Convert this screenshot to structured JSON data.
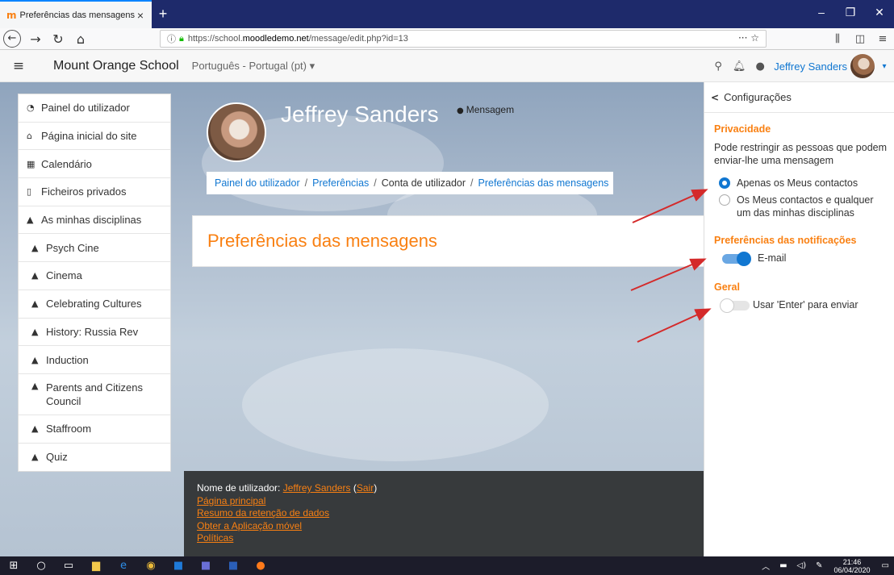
{
  "browser": {
    "tab_title": "Preferências das mensagens",
    "favicon": "m",
    "tab_close": "×",
    "new_tab": "+",
    "url_prefix": "https://school.",
    "url_domain": "moodledemo.net",
    "url_path": "/message/edit.php?id=13",
    "url_actions": "··· ☆"
  },
  "header": {
    "site_name": "Mount Orange School",
    "language": "Português - Portugal (pt) ▾",
    "user_name": "Jeffrey Sanders",
    "caret": "▾"
  },
  "leftnav": {
    "items": [
      {
        "label": "Painel do utilizador",
        "icon": "dashboard-icon"
      },
      {
        "label": "Página inicial do site",
        "icon": "home-icon"
      },
      {
        "label": "Calendário",
        "icon": "calendar-icon"
      },
      {
        "label": "Ficheiros privados",
        "icon": "file-icon"
      },
      {
        "label": "As minhas disciplinas",
        "icon": "graduation-cap-icon"
      },
      {
        "label": "Psych Cine",
        "icon": "graduation-cap-icon"
      },
      {
        "label": "Cinema",
        "icon": "graduation-cap-icon"
      },
      {
        "label": "Celebrating Cultures",
        "icon": "graduation-cap-icon"
      },
      {
        "label": "History: Russia Rev",
        "icon": "graduation-cap-icon"
      },
      {
        "label": "Induction",
        "icon": "graduation-cap-icon"
      },
      {
        "label": "Parents and Citizens Council",
        "icon": "graduation-cap-icon"
      },
      {
        "label": "Staffroom",
        "icon": "graduation-cap-icon"
      },
      {
        "label": "Quiz",
        "icon": "graduation-cap-icon"
      }
    ]
  },
  "profile": {
    "name": "Jeffrey Sanders",
    "message_link": "Mensagem"
  },
  "breadcrumb": {
    "items": [
      "Painel do utilizador",
      "Preferências",
      "Conta de utilizador",
      "Preferências das mensagens"
    ],
    "separator": "/"
  },
  "page": {
    "title": "Preferências das mensagens"
  },
  "footer": {
    "logged_in_prefix": "Nome de utilizador: ",
    "user_link": "Jeffrey Sanders",
    "logout_link": "Sair",
    "links": [
      "Página principal",
      "Resumo da retenção de dados",
      "Obter a Aplicação móvel",
      "Políticas"
    ]
  },
  "drawer": {
    "title": "Configurações",
    "privacy": {
      "heading": "Privacidade",
      "description": "Pode restringir as pessoas que podem enviar-lhe uma mensagem",
      "options": [
        {
          "label": "Apenas os Meus contactos",
          "selected": true
        },
        {
          "label": "Os Meus contactos e qualquer um das minhas disciplinas",
          "selected": false
        }
      ]
    },
    "notifications": {
      "heading": "Preferências das notificações",
      "email_label": "E-mail",
      "email_on": true
    },
    "general": {
      "heading": "Geral",
      "enter_label": "Usar 'Enter' para enviar",
      "enter_on": false
    }
  },
  "taskbar": {
    "time": "21:46",
    "date": "06/04/2020"
  },
  "colors": {
    "accent": "#f98012",
    "link": "#1177d1",
    "arrow": "#d42a2a"
  }
}
